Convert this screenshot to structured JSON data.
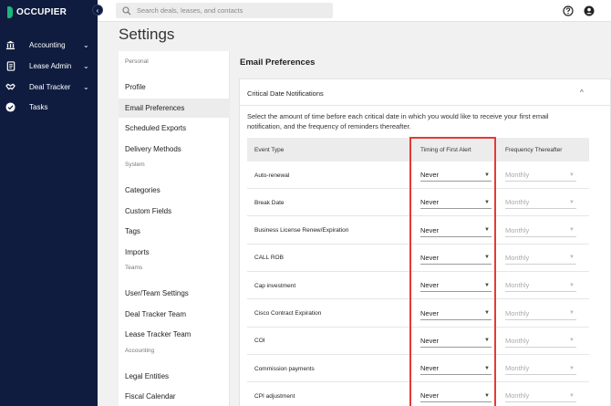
{
  "app": {
    "logo_text": "OCCUPIER",
    "collapse_glyph": "‹"
  },
  "sidebar": {
    "items": [
      {
        "label": "Accounting",
        "icon": "bank-icon",
        "chevron": "⌄"
      },
      {
        "label": "Lease Admin",
        "icon": "document-icon",
        "chevron": "⌄"
      },
      {
        "label": "Deal Tracker",
        "icon": "handshake-icon",
        "chevron": "⌄"
      },
      {
        "label": "Tasks",
        "icon": "check-circle-icon",
        "chevron": ""
      }
    ]
  },
  "topbar": {
    "search_placeholder": "Search deals, leases, and contacts",
    "icons": [
      "help-icon",
      "user-icon"
    ]
  },
  "page": {
    "title": "Settings"
  },
  "settings_menu": {
    "entries": [
      {
        "type": "section",
        "label": "Personal"
      },
      {
        "type": "item",
        "label": "Profile"
      },
      {
        "type": "item",
        "label": "Email Preferences",
        "active": true
      },
      {
        "type": "item",
        "label": "Scheduled Exports"
      },
      {
        "type": "item",
        "label": "Delivery Methods"
      },
      {
        "type": "section",
        "label": "System"
      },
      {
        "type": "item",
        "label": "Categories"
      },
      {
        "type": "item",
        "label": "Custom Fields"
      },
      {
        "type": "item",
        "label": "Tags"
      },
      {
        "type": "item",
        "label": "Imports"
      },
      {
        "type": "section",
        "label": "Teams"
      },
      {
        "type": "item",
        "label": "User/Team Settings"
      },
      {
        "type": "item",
        "label": "Deal Tracker Team"
      },
      {
        "type": "item",
        "label": "Lease Tracker Team"
      },
      {
        "type": "section",
        "label": "Accounting"
      },
      {
        "type": "item",
        "label": "Legal Entities"
      },
      {
        "type": "item",
        "label": "Fiscal Calendar"
      }
    ]
  },
  "email_prefs": {
    "title": "Email Preferences",
    "card_header": "Critical Date Notifications",
    "card_chevron": "^",
    "description": "Select the amount of time before each critical date in which you would like to receive your first email notification, and the frequency of reminders thereafter.",
    "columns": [
      "Event Type",
      "Timing of First Alert",
      "Frequency Thereafter"
    ],
    "caret": "▼",
    "rows": [
      {
        "event": "Auto-renewal",
        "timing": "Never",
        "frequency": "Monthly"
      },
      {
        "event": "Break Date",
        "timing": "Never",
        "frequency": "Monthly"
      },
      {
        "event": "Business License Renew/Expiration",
        "timing": "Never",
        "frequency": "Monthly"
      },
      {
        "event": "CALL ROB",
        "timing": "Never",
        "frequency": "Monthly"
      },
      {
        "event": "Cap investment",
        "timing": "Never",
        "frequency": "Monthly"
      },
      {
        "event": "Cisco Contract Expiration",
        "timing": "Never",
        "frequency": "Monthly"
      },
      {
        "event": "COI",
        "timing": "Never",
        "frequency": "Monthly"
      },
      {
        "event": "Commission payments",
        "timing": "Never",
        "frequency": "Monthly"
      },
      {
        "event": "CPI adjustment",
        "timing": "Never",
        "frequency": "Monthly"
      }
    ]
  },
  "colors": {
    "sidebar_bg": "#0f1c3f",
    "brand_green": "#1fb47a",
    "highlight": "#e53935"
  }
}
